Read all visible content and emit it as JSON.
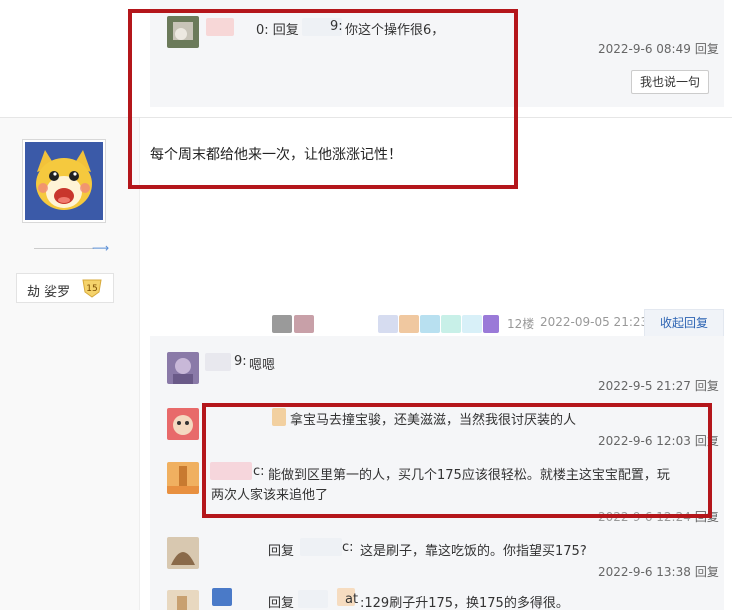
{
  "top_reply": {
    "prefix": "0: 回复",
    "sep": "9:",
    "text": "你这个操作很6，",
    "time": "2022-9-6 08:49",
    "reply_label": "回复",
    "say_button": "我也说一句"
  },
  "post": {
    "text": "每个周末都给他来一次，让他涨涨记性！",
    "user_name": "劫 娑罗",
    "level": "15",
    "floor": "12楼",
    "floor_time": "2022-09-05 21:23",
    "collapse_label": "收起回复"
  },
  "replies": [
    {
      "prefix": "9:",
      "text": "嗯嗯",
      "time": "2022-9-5 21:27",
      "reply_label": "回复"
    },
    {
      "prefix": "",
      "text": "拿宝马去撞宝骏，还美滋滋，当然我很讨厌装的人",
      "time": "2022-9-6 12:03",
      "reply_label": "回复"
    },
    {
      "prefix": "c:",
      "text": "能做到区里第一的人，买几个175应该很轻松。就楼主这宝宝配置，玩",
      "text2": "两次人家该来追他了",
      "time": "2022-9-6 12:24",
      "reply_label": "回复"
    },
    {
      "prefix": "回复",
      "sep": "c:",
      "text": "这是刷子，靠这吃饭的。你指望买175?",
      "time": "2022-9-6 13:38",
      "reply_label": "回复"
    },
    {
      "prefix": "回复",
      "sep": "at",
      "text": ":129刷子升175，换175的多得很。",
      "time": "",
      "reply_label": ""
    }
  ]
}
